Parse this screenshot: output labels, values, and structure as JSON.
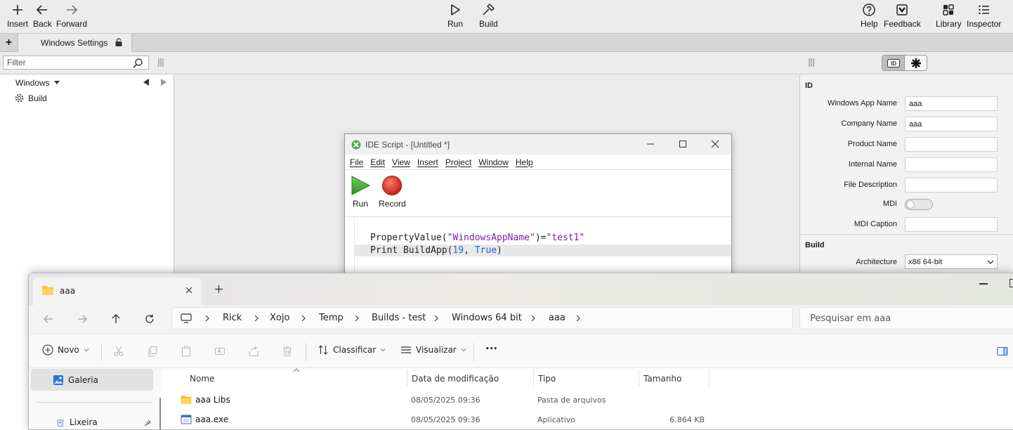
{
  "ide": {
    "toolbar": {
      "insert": "Insert",
      "back": "Back",
      "forward": "Forward",
      "run": "Run",
      "build": "Build",
      "help": "Help",
      "feedback": "Feedback",
      "library": "Library",
      "inspector": "Inspector"
    },
    "tab": {
      "add": "+",
      "label": "Windows Settings",
      "icon": "lock-icon"
    },
    "filter": {
      "placeholder": "Filter"
    },
    "navigator": {
      "group": "Windows",
      "item": "Build"
    },
    "inspector": {
      "segments": [
        "id-icon",
        "gear-icon"
      ],
      "section_id": "ID",
      "fields": [
        {
          "label": "Windows App Name",
          "value": "aaa"
        },
        {
          "label": "Company Name",
          "value": "aaa"
        },
        {
          "label": "Product Name",
          "value": ""
        },
        {
          "label": "Internal Name",
          "value": ""
        },
        {
          "label": "File Description",
          "value": ""
        }
      ],
      "mdi_label": "MDI",
      "mdi_on": false,
      "mdi_caption_label": "MDI Caption",
      "mdi_caption_value": "",
      "section_build": "Build",
      "arch_label": "Architecture",
      "arch_value": "x86 64-bit"
    }
  },
  "script_window": {
    "title": "IDE Script - [Untitled *]",
    "menu": [
      "File",
      "Edit",
      "View",
      "Insert",
      "Project",
      "Window",
      "Help"
    ],
    "run_label": "Run",
    "record_label": "Record",
    "code": {
      "line1": {
        "fn": "PropertyValue(",
        "str": "\"WindowsAppName\"",
        "mid": ")=",
        "str2": "\"test1\""
      },
      "line2": {
        "pre": "Print BuildApp(",
        "num": "19",
        "sep": ", ",
        "kw": "True",
        "post": ")"
      }
    },
    "colors": {
      "run_green": "#3fa534",
      "record_red": "#d8261c"
    }
  },
  "explorer": {
    "tab_title": "aaa",
    "breadcrumbs": [
      "Rick",
      "Xojo",
      "Temp",
      "Builds - test",
      "Windows 64 bit",
      "aaa"
    ],
    "search_placeholder": "Pesquisar em aaa",
    "commands": {
      "new": "Novo",
      "sort": "Classificar",
      "view": "Visualizar",
      "more": "···"
    },
    "sidebar": {
      "gallery": "Galeria",
      "recycle": "Lixeira"
    },
    "columns": {
      "name": "Nome",
      "modified": "Data de modificação",
      "type": "Tipo",
      "size": "Tamanho"
    },
    "files": [
      {
        "name": "aaa Libs",
        "modified": "08/05/2025 09:36",
        "type": "Pasta de arquivos",
        "size": "",
        "icon": "folder-icon"
      },
      {
        "name": "aaa.exe",
        "modified": "08/05/2025 09:36",
        "type": "Aplicativo",
        "size": "6.864 KB",
        "icon": "exe-icon"
      }
    ]
  }
}
